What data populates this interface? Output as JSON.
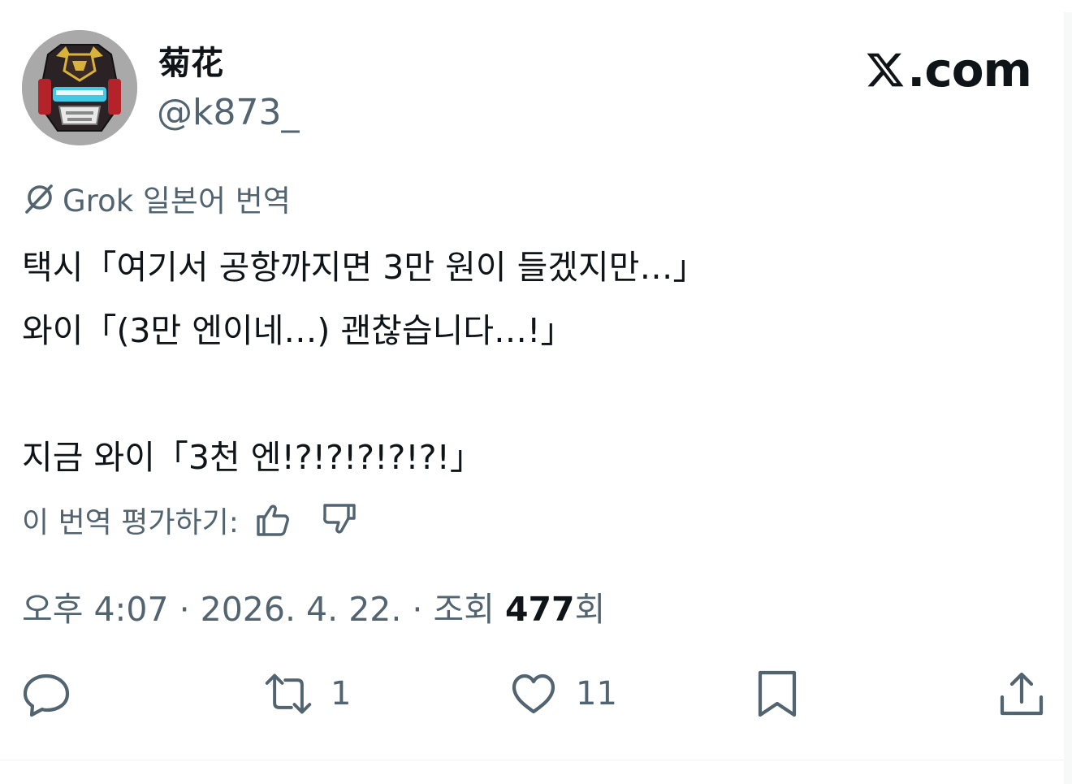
{
  "author": {
    "name": "菊花",
    "handle": "@k873_"
  },
  "brand": {
    "logo_text": ".com"
  },
  "translation": {
    "label": "Grok 일본어 번역",
    "lines": [
      "택시「여기서 공항까지면 3만 원이 들겠지만…」",
      "와이「(3만 엔이네…) 괜찮습니다…!」",
      "",
      "지금 와이「3천 엔!?!?!?!?!?!」"
    ],
    "rate_label": "이 번역 평가하기:"
  },
  "meta": {
    "timestamp": "오후 4:07 · 2026. 4. 22. · 조회 ",
    "views": "477",
    "views_suffix": "회"
  },
  "actions": {
    "reply_count": "",
    "repost_count": "1",
    "like_count": "11"
  },
  "icons": {
    "grok": "grok-icon",
    "thumbs_up": "thumbs-up-icon",
    "thumbs_down": "thumbs-down-icon",
    "reply": "reply-icon",
    "repost": "repost-icon",
    "like": "heart-icon",
    "bookmark": "bookmark-icon",
    "share": "share-icon"
  },
  "colors": {
    "text_primary": "#0f1419",
    "text_secondary": "#536471",
    "divider": "#eff3f4"
  }
}
